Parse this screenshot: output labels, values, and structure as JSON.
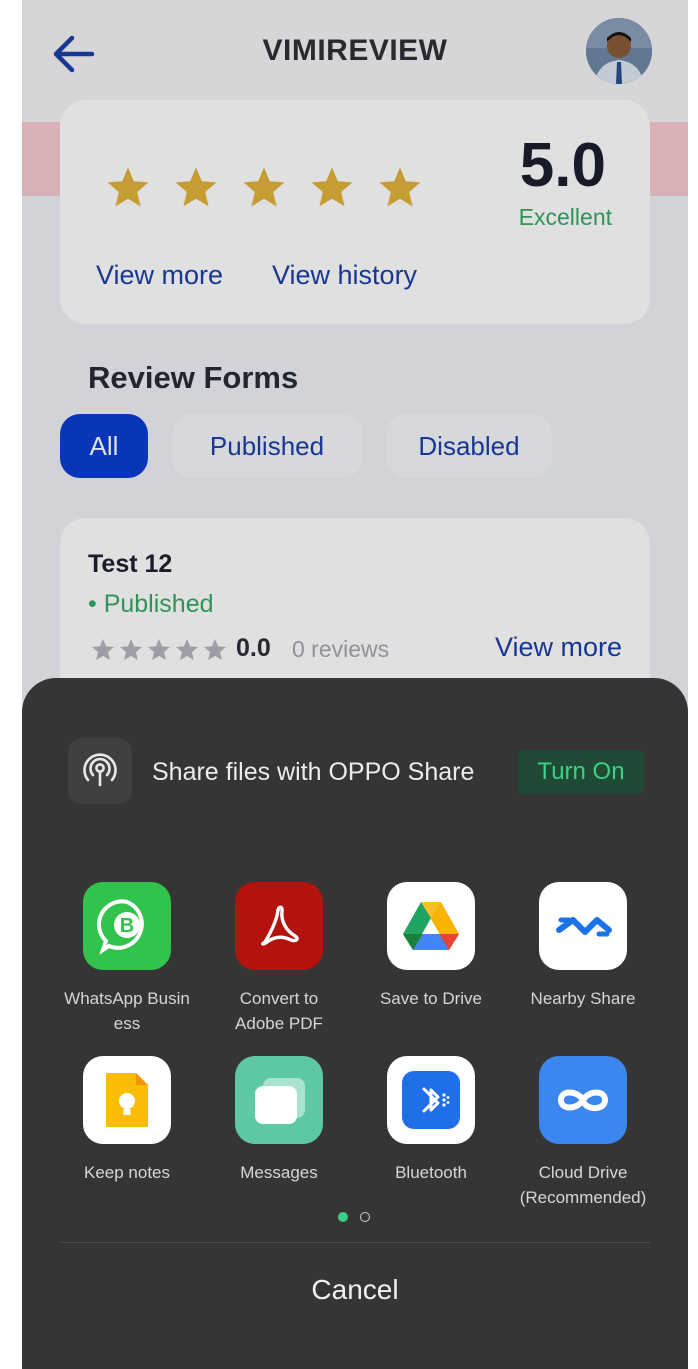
{
  "header": {
    "title": "VIMIREVIEW"
  },
  "rating_summary": {
    "score": "5.0",
    "label": "Excellent",
    "stars": 5,
    "view_more": "View more",
    "view_history": "View history"
  },
  "review_forms": {
    "title": "Review Forms",
    "filters": [
      "All",
      "Published",
      "Disabled"
    ],
    "selected_filter": "All",
    "forms": [
      {
        "name": "Test 12",
        "status": "• Published",
        "score": "0.0",
        "reviews": "0 reviews",
        "view_more": "View more"
      }
    ]
  },
  "share_sheet": {
    "oppo_share_text": "Share files with OPPO Share",
    "turn_on": "Turn On",
    "apps": [
      {
        "label": "WhatsApp Busin\ness",
        "icon": "whatsapp-business-icon"
      },
      {
        "label": "Convert to\nAdobe PDF",
        "icon": "adobe-pdf-icon"
      },
      {
        "label": "Save to Drive",
        "icon": "google-drive-icon"
      },
      {
        "label": "Nearby Share",
        "icon": "nearby-share-icon"
      },
      {
        "label": "Keep notes",
        "icon": "keep-notes-icon"
      },
      {
        "label": "Messages",
        "icon": "messages-icon"
      },
      {
        "label": "Bluetooth",
        "icon": "bluetooth-icon"
      },
      {
        "label": "Cloud Drive\n(Recommended)",
        "icon": "cloud-drive-icon"
      }
    ],
    "page_indicator": {
      "current": 1,
      "total": 2
    },
    "cancel": "Cancel"
  },
  "colors": {
    "accent_blue": "#0b3ed2",
    "link_blue": "#1c3fa8",
    "success_green": "#38a866",
    "star_gold": "#e2b33a",
    "sheet_bg": "#353535",
    "turn_on_green": "#3ccf86"
  }
}
